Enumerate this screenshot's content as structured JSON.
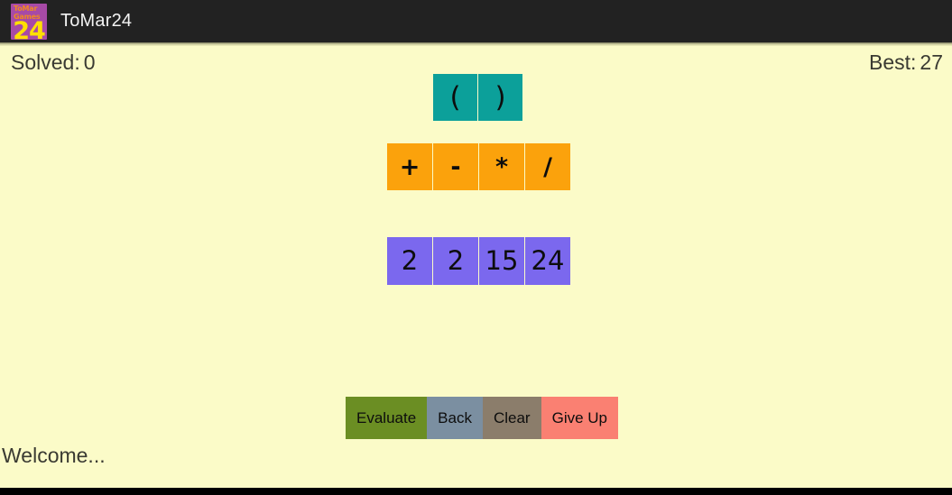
{
  "window": {
    "title": "ToMar24",
    "icon": {
      "name": "tomar24-app-icon",
      "brand_line1": "ToMar",
      "brand_line2": "Games",
      "number": "24"
    }
  },
  "status": {
    "solved_label": "Solved:",
    "solved_value": "0",
    "best_label": "Best:",
    "best_value": "27"
  },
  "paren_buttons": [
    {
      "label": "(",
      "name": "paren-open-button"
    },
    {
      "label": ")",
      "name": "paren-close-button"
    }
  ],
  "operator_buttons": [
    {
      "label": "+",
      "name": "operator-plus-button"
    },
    {
      "label": "-",
      "name": "operator-minus-button"
    },
    {
      "label": "*",
      "name": "operator-multiply-button"
    },
    {
      "label": "/",
      "name": "operator-divide-button"
    }
  ],
  "number_buttons": [
    {
      "label": "2",
      "name": "number-button-1"
    },
    {
      "label": "2",
      "name": "number-button-2"
    },
    {
      "label": "15",
      "name": "number-button-3"
    },
    {
      "label": "24",
      "name": "number-button-4"
    }
  ],
  "action_buttons": [
    {
      "label": "Evaluate",
      "name": "evaluate-button"
    },
    {
      "label": "Back",
      "name": "back-button"
    },
    {
      "label": "Clear",
      "name": "clear-button"
    },
    {
      "label": "Give Up",
      "name": "give-up-button"
    }
  ],
  "message": {
    "text": "Welcome..."
  },
  "colors": {
    "background": "#fbfbc8",
    "titlebar": "#222222",
    "paren": "#0ca09a",
    "operator": "#fba20c",
    "number": "#7b68ee",
    "evaluate": "#6b8e23",
    "back": "#7b8fa1",
    "clear": "#8b7d6b",
    "give_up": "#fa8072",
    "icon_background": "#a74aa6",
    "icon_number": "#ffe000",
    "icon_brand": "#f08a22"
  }
}
